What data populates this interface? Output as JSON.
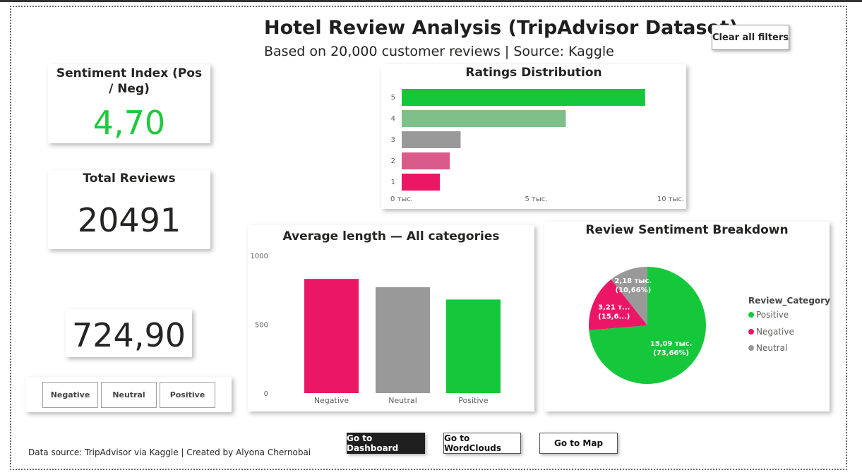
{
  "header": {
    "title": "Hotel Review Analysis (TripAdvisor Dataset)",
    "subtitle": "Based on 20,000 customer reviews | Source: Kaggle",
    "clear_filters_label": "Clear all filters"
  },
  "kpis": {
    "sentiment_label": "Sentiment Index (Pos / Neg)",
    "sentiment_value": "4,70",
    "sentiment_color": "#1fc93c",
    "total_label": "Total Reviews",
    "total_value": "20491",
    "avg_value": "724,90"
  },
  "slicer": {
    "buttons": [
      "Negative",
      "Neutral",
      "Positive"
    ]
  },
  "colors": {
    "positive": "#15c83b",
    "negative": "#eb1766",
    "neutral": "#999999"
  },
  "chart_data": [
    {
      "type": "bar",
      "orientation": "horizontal",
      "title": "Ratings Distribution",
      "categories": [
        "5",
        "4",
        "3",
        "2",
        "1"
      ],
      "values": [
        9050,
        6100,
        2190,
        1790,
        1420
      ],
      "bar_colors": [
        "#15c83b",
        "#7ebf8a",
        "#999999",
        "#d95b8a",
        "#eb1766"
      ],
      "ticks": [
        "0 тыс.",
        "5 тыс.",
        "10 тыс."
      ],
      "xlim": [
        0,
        10000
      ]
    },
    {
      "type": "bar",
      "title": "Average length — All categories",
      "categories": [
        "Negative",
        "Neutral",
        "Positive"
      ],
      "values": [
        830,
        770,
        680
      ],
      "bar_colors": [
        "#eb1766",
        "#999999",
        "#15c83b"
      ],
      "ticks": [
        "1000",
        "500",
        "0"
      ],
      "ylim": [
        0,
        1000
      ]
    },
    {
      "type": "pie",
      "title": "Review Sentiment Breakdown",
      "legend_title": "Review_Category",
      "categories": [
        "Positive",
        "Negative",
        "Neutral"
      ],
      "values": [
        15090,
        3210,
        2180
      ],
      "percents": [
        73.66,
        15.6,
        10.66
      ],
      "colors": [
        "#15c83b",
        "#eb1766",
        "#999999"
      ],
      "labels": [
        [
          "15,09 тыс.",
          "(73,66%)"
        ],
        [
          "3,21 т...",
          "(15,6...)"
        ],
        [
          "2,18 тыс.",
          "(10,66%)"
        ]
      ],
      "legend_placement": "right"
    }
  ],
  "nav": {
    "dashboard": "Go to Dashboard",
    "wordclouds": "Go to WordClouds",
    "map": "Go to Map"
  },
  "footer": {
    "text": "Data source: TripAdvisor via Kaggle | Created by Alyona Chernobai"
  }
}
